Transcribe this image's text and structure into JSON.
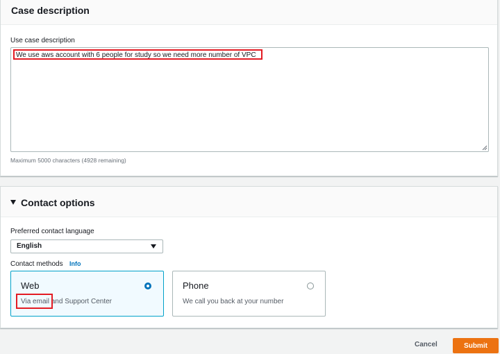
{
  "case_description": {
    "title": "Case description",
    "field_label": "Use case description",
    "value": "We use aws account with 6 people for study so we need more number of VPC",
    "hint": "Maximum 5000 characters (4928 remaining)"
  },
  "contact_options": {
    "title": "Contact options",
    "language_label": "Preferred contact language",
    "language_value": "English",
    "methods_label": "Contact methods",
    "info_label": "Info",
    "methods": [
      {
        "title": "Web",
        "subtitle": "Via email and Support Center",
        "selected": true
      },
      {
        "title": "Phone",
        "subtitle": "We call you back at your number",
        "selected": false
      }
    ]
  },
  "actions": {
    "cancel_label": "Cancel",
    "submit_label": "Submit"
  },
  "colors": {
    "accent": "#0073bb",
    "primary_button": "#ec7211",
    "highlight_annotation": "#e31b23"
  }
}
